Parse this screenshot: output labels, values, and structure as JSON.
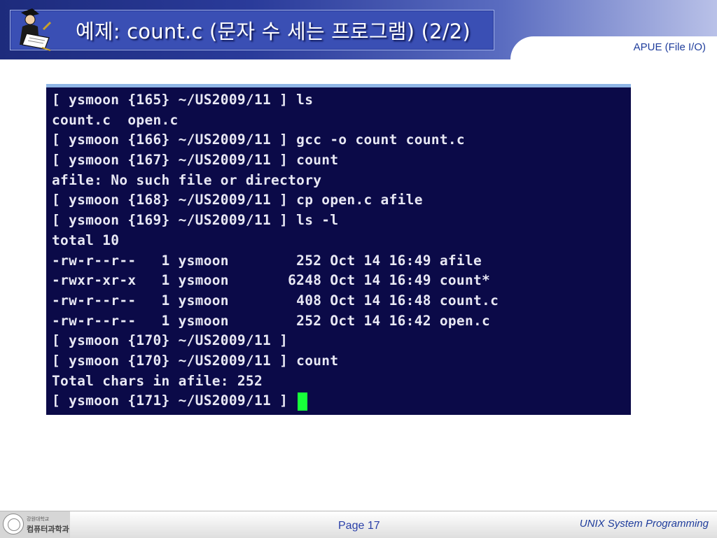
{
  "header": {
    "title": "예제: count.c (문자 수 세는 프로그램) (2/2)",
    "subject": "APUE (File I/O)",
    "logo_icon": "man-reading-notebook-icon"
  },
  "terminal": {
    "lines": [
      "[ ysmoon {165} ~/US2009/11 ] ls",
      "count.c  open.c",
      "[ ysmoon {166} ~/US2009/11 ] gcc -o count count.c",
      "[ ysmoon {167} ~/US2009/11 ] count",
      "afile: No such file or directory",
      "[ ysmoon {168} ~/US2009/11 ] cp open.c afile",
      "[ ysmoon {169} ~/US2009/11 ] ls -l",
      "total 10",
      "-rw-r--r--   1 ysmoon        252 Oct 14 16:49 afile",
      "-rwxr-xr-x   1 ysmoon       6248 Oct 14 16:49 count*",
      "-rw-r--r--   1 ysmoon        408 Oct 14 16:48 count.c",
      "-rw-r--r--   1 ysmoon        252 Oct 14 16:42 open.c",
      "[ ysmoon {170} ~/US2009/11 ]",
      "[ ysmoon {170} ~/US2009/11 ] count",
      "Total chars in afile: 252",
      "[ ysmoon {171} ~/US2009/11 ] "
    ],
    "background_color": "#0b0a48",
    "text_color": "#e8e8f4",
    "cursor_color": "#17ff3a"
  },
  "footer": {
    "university_small": "강원대학교",
    "department": "컴퓨터과학과",
    "page": "Page 17",
    "course": "UNIX System Programming"
  }
}
